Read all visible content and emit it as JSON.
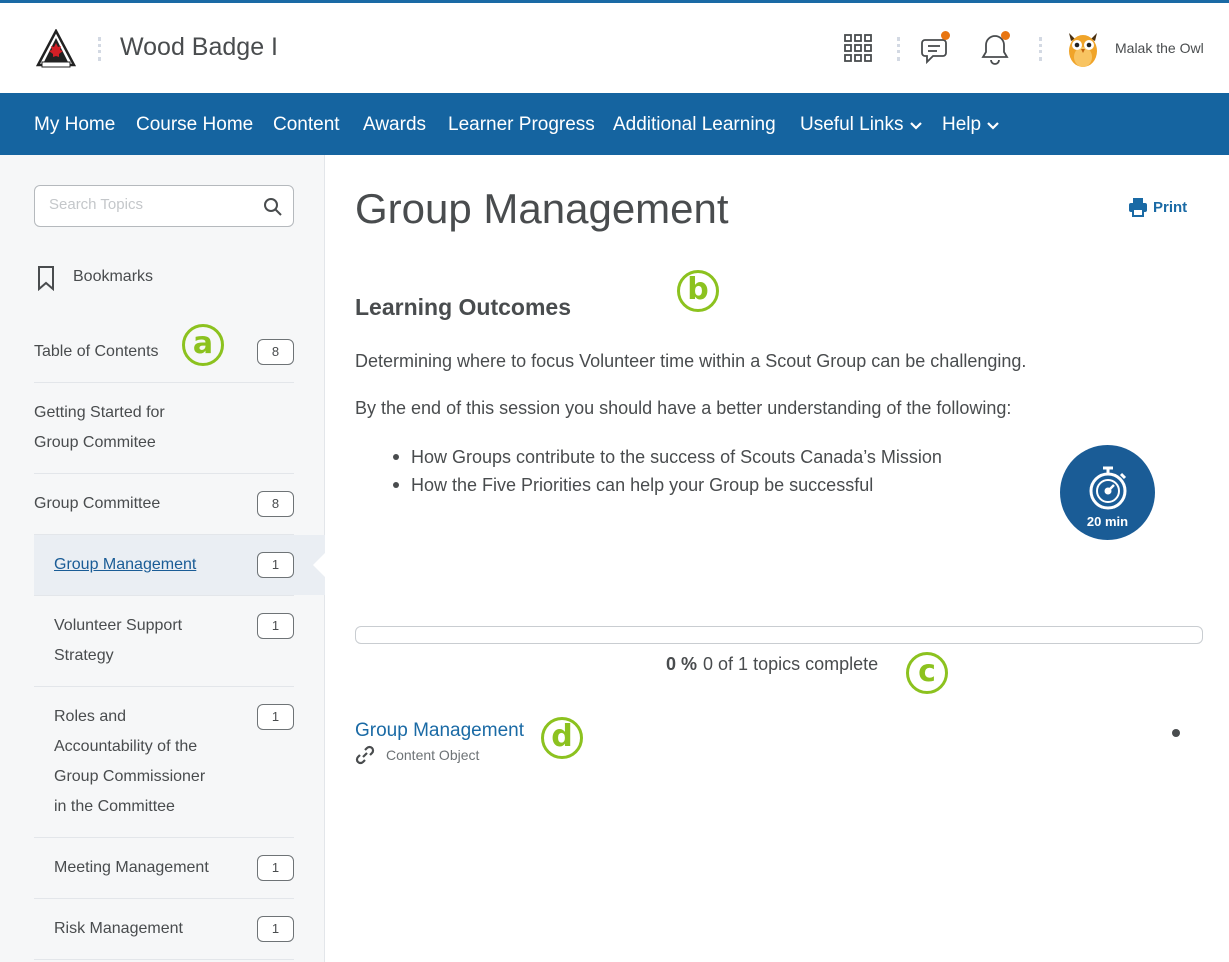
{
  "header": {
    "course_title": "Wood Badge I",
    "user_name": "Malak the Owl",
    "notification_color": "#e87511"
  },
  "nav": {
    "items": [
      "My Home",
      "Course Home",
      "Content",
      "Awards",
      "Learner Progress",
      "Additional Learning",
      "Useful Links",
      "Help"
    ]
  },
  "sidebar": {
    "search_placeholder": "Search Topics",
    "bookmarks_label": "Bookmarks",
    "toc": [
      {
        "label": "Table of Contents",
        "count": "8"
      },
      {
        "label": "Getting Started for Group Commitee"
      },
      {
        "label": "Group Committee",
        "count": "8"
      },
      {
        "label": "Group Management",
        "count": "1",
        "active": true
      },
      {
        "label": "Volunteer Support Strategy",
        "count": "1"
      },
      {
        "label": "Roles and Accountability of the Group Commissioner in the Committee",
        "count": "1"
      },
      {
        "label": "Meeting Management",
        "count": "1"
      },
      {
        "label": "Risk Management",
        "count": "1"
      }
    ]
  },
  "markers": {
    "a": "a",
    "b": "b",
    "c": "c",
    "d": "d"
  },
  "main": {
    "title": "Group Management",
    "print_label": "Print",
    "section_heading": "Learning Outcomes",
    "para1": "Determining where to focus Volunteer time within a Scout Group can be challenging.",
    "para2": "By the end of this session you should have a better understanding of the following:",
    "bullets": [
      "How Groups contribute to the success of Scouts Canada’s Mission",
      "How the Five Priorities can help your Group be successful"
    ],
    "duration": "20 min",
    "progress": {
      "percent_label": "0 %",
      "summary": "0 of 1 topics complete",
      "fraction": 0
    },
    "item": {
      "title": "Group Management",
      "type": "Content Object"
    }
  }
}
